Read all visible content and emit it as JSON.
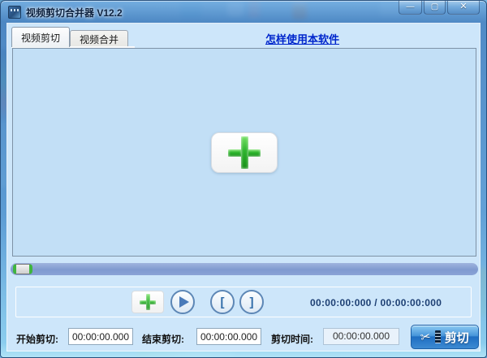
{
  "window": {
    "title": "视频剪切合并器 V12.2",
    "minimize_glyph": "—",
    "maximize_glyph": "▢",
    "close_glyph": "✕"
  },
  "tabs": [
    {
      "label": "视频剪切",
      "active": true
    },
    {
      "label": "视频合并",
      "active": false
    }
  ],
  "help_link": {
    "label": "怎样使用本软件"
  },
  "transport": {
    "time_display": "00:00:00:000 / 00:00:00:000",
    "set_start_glyph": "[",
    "set_end_glyph": "]"
  },
  "cut": {
    "start_label": "开始剪切:",
    "start_value": "00:00:00.000",
    "end_label": "结束剪切:",
    "end_value": "00:00:00.000",
    "duration_label": "剪切时间:",
    "duration_value": "00:00:00.000",
    "cut_button_label": "剪切"
  },
  "colors": {
    "link": "#0026cc",
    "plus_green": "#2db32d",
    "cut_button_blue": "#1f6ec2",
    "slider_track": "#8aa3d6",
    "client_bg": "#cde6fa",
    "video_area_bg": "#c2dff6",
    "titlebar_glass": "#4a84c2",
    "time_text": "#1d3f73"
  }
}
